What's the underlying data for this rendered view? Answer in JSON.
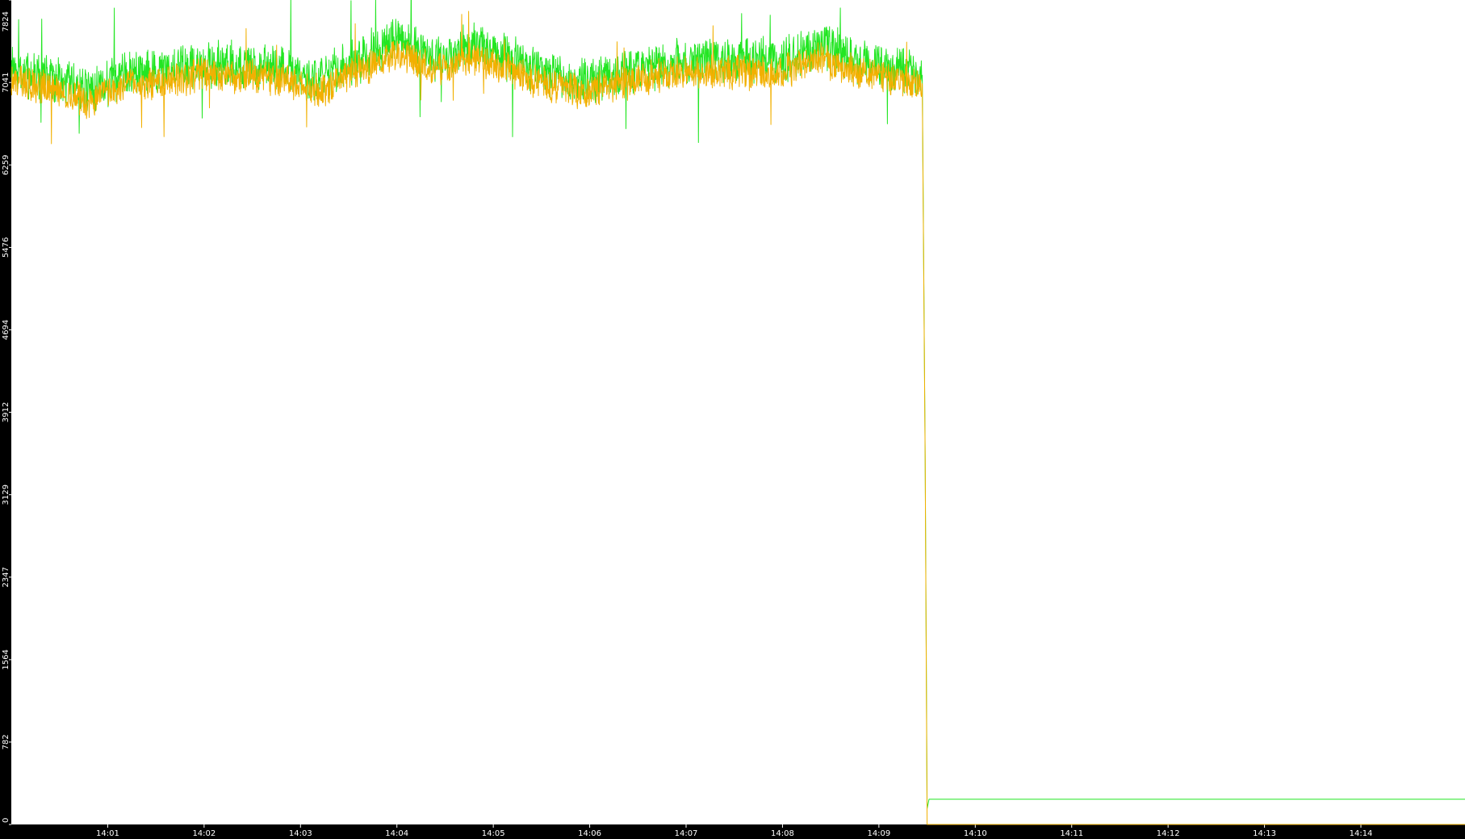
{
  "chart_data": {
    "type": "line",
    "title": "",
    "xlabel": "",
    "ylabel": "",
    "grid": false,
    "legend": "none",
    "colors": {
      "background": "#000000",
      "plot_area": "#ffffff",
      "tick_text": "#ffffff",
      "series_green": "#22e622",
      "series_orange": "#f2b000"
    },
    "x_unit": "minutes after 14:00",
    "xlim": [
      0,
      15.08
    ],
    "ylim": [
      0,
      7824
    ],
    "yticks": [
      0,
      782,
      1564,
      2347,
      3129,
      3912,
      4694,
      5476,
      6259,
      7041,
      7824
    ],
    "ytick_labels": [
      "0",
      "782",
      "1564",
      "2347",
      "3129",
      "3912",
      "4694",
      "5476",
      "6259",
      "7041",
      "7824"
    ],
    "xticks": [
      1,
      2,
      3,
      4,
      5,
      6,
      7,
      8,
      9,
      10,
      11,
      12,
      13,
      14
    ],
    "xtick_labels": [
      "14:01",
      "14:02",
      "14:03",
      "14:04",
      "14:05",
      "14:06",
      "14:07",
      "14:08",
      "14:09",
      "14:10",
      "14:11",
      "14:12",
      "14:13",
      "14:14"
    ],
    "series": [
      {
        "color": "#22e622",
        "noise": 190,
        "seed": 7,
        "x": [
          0,
          0.4,
          0.8,
          1.2,
          1.6,
          2.0,
          2.4,
          2.8,
          3.2,
          3.6,
          4.0,
          4.4,
          4.8,
          5.2,
          5.6,
          6.0,
          6.4,
          6.8,
          7.2,
          7.6,
          8.0,
          8.4,
          8.8,
          9.2,
          9.45,
          9.48,
          9.5,
          9.52,
          15.08
        ],
        "y": [
          7140,
          7090,
          6960,
          7120,
          7160,
          7210,
          7200,
          7180,
          7060,
          7250,
          7450,
          7260,
          7380,
          7260,
          7100,
          7050,
          7150,
          7220,
          7260,
          7250,
          7240,
          7380,
          7250,
          7160,
          7110,
          3480,
          150,
          240,
          240
        ]
      },
      {
        "color": "#f2b000",
        "noise": 140,
        "seed": 13,
        "x": [
          0,
          0.4,
          0.8,
          1.2,
          1.6,
          2.0,
          2.4,
          2.8,
          3.2,
          3.6,
          4.0,
          4.4,
          4.8,
          5.2,
          5.6,
          6.0,
          6.4,
          6.8,
          7.2,
          7.6,
          8.0,
          8.4,
          8.8,
          9.2,
          9.45,
          9.48,
          9.5,
          9.52,
          15.08
        ],
        "y": [
          7060,
          6990,
          6860,
          7020,
          7060,
          7110,
          7100,
          7080,
          6960,
          7150,
          7330,
          7160,
          7270,
          7160,
          7000,
          6950,
          7050,
          7110,
          7150,
          7140,
          7130,
          7270,
          7140,
          7060,
          7010,
          3460,
          0,
          0,
          0
        ]
      }
    ]
  }
}
